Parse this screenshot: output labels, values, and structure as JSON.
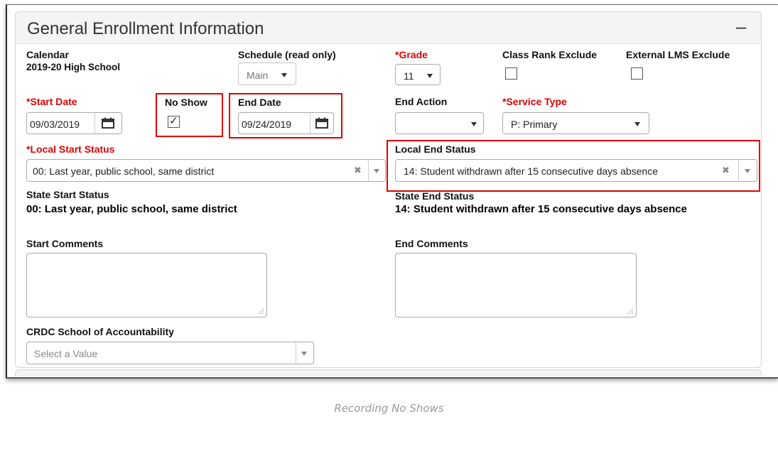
{
  "panel": {
    "title": "General Enrollment Information",
    "collapse_symbol": "–"
  },
  "fields": {
    "calendar": {
      "label": "Calendar",
      "value": "2019-20 High School"
    },
    "schedule": {
      "label": "Schedule (read only)",
      "value": "Main"
    },
    "grade": {
      "required_mark": "*",
      "label": "Grade",
      "value": "11"
    },
    "class_rank_exclude": {
      "label": "Class Rank Exclude",
      "checked": false
    },
    "external_lms_exclude": {
      "label": "External LMS Exclude",
      "checked": false
    },
    "start_date": {
      "required_mark": "*",
      "label": "Start Date",
      "value": "09/03/2019"
    },
    "no_show": {
      "label": "No Show",
      "checked": true,
      "check_glyph": "✓"
    },
    "end_date": {
      "label": "End Date",
      "value": "09/24/2019"
    },
    "end_action": {
      "label": "End Action",
      "value": ""
    },
    "service_type": {
      "required_mark": "*",
      "label": "Service Type",
      "value": "P: Primary"
    },
    "local_start_status": {
      "required_mark": "*",
      "label": "Local Start Status",
      "value": "00: Last year, public school, same district",
      "clear_symbol": "✖"
    },
    "local_end_status": {
      "label": "Local End Status",
      "value": "14: Student withdrawn after 15 consecutive days absence",
      "clear_symbol": "✖"
    },
    "state_start_status": {
      "label": "State Start Status",
      "value": "00: Last year, public school, same district"
    },
    "state_end_status": {
      "label": "State End Status",
      "value": "14: Student withdrawn after 15 consecutive days absence"
    },
    "start_comments": {
      "label": "Start Comments",
      "value": ""
    },
    "end_comments": {
      "label": "End Comments",
      "value": ""
    },
    "crdc_school": {
      "label": "CRDC School of Accountability",
      "placeholder": "Select a Value"
    }
  },
  "caption": "Recording No Shows",
  "colors": {
    "required": "#e00000",
    "highlight": "#e00000",
    "header_bg": "#f4f4f4",
    "caption": "#999999"
  },
  "icons": {
    "calendar": "calendar-icon",
    "dropdown": "chevron-down-icon",
    "clear": "clear-x-icon",
    "resize": "resize-grip-icon"
  }
}
